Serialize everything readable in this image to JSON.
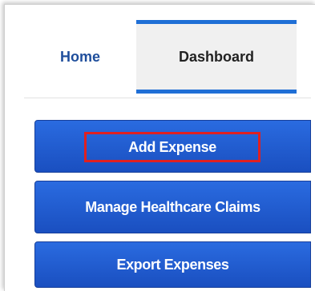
{
  "nav": {
    "tabs": [
      {
        "label": "Home",
        "state": "inactive"
      },
      {
        "label": "Dashboard",
        "state": "active"
      }
    ]
  },
  "actions": {
    "add_expense": {
      "label": "Add Expense",
      "highlighted": true
    },
    "manage_claims": {
      "label": "Manage Healthcare Claims"
    },
    "export_expenses": {
      "label": "Export Expenses"
    }
  },
  "colors": {
    "button_blue": "#1f5fd1",
    "active_tab_accent": "#1f6fd6",
    "home_text": "#1f4e9c",
    "highlight_red": "#e02020"
  }
}
